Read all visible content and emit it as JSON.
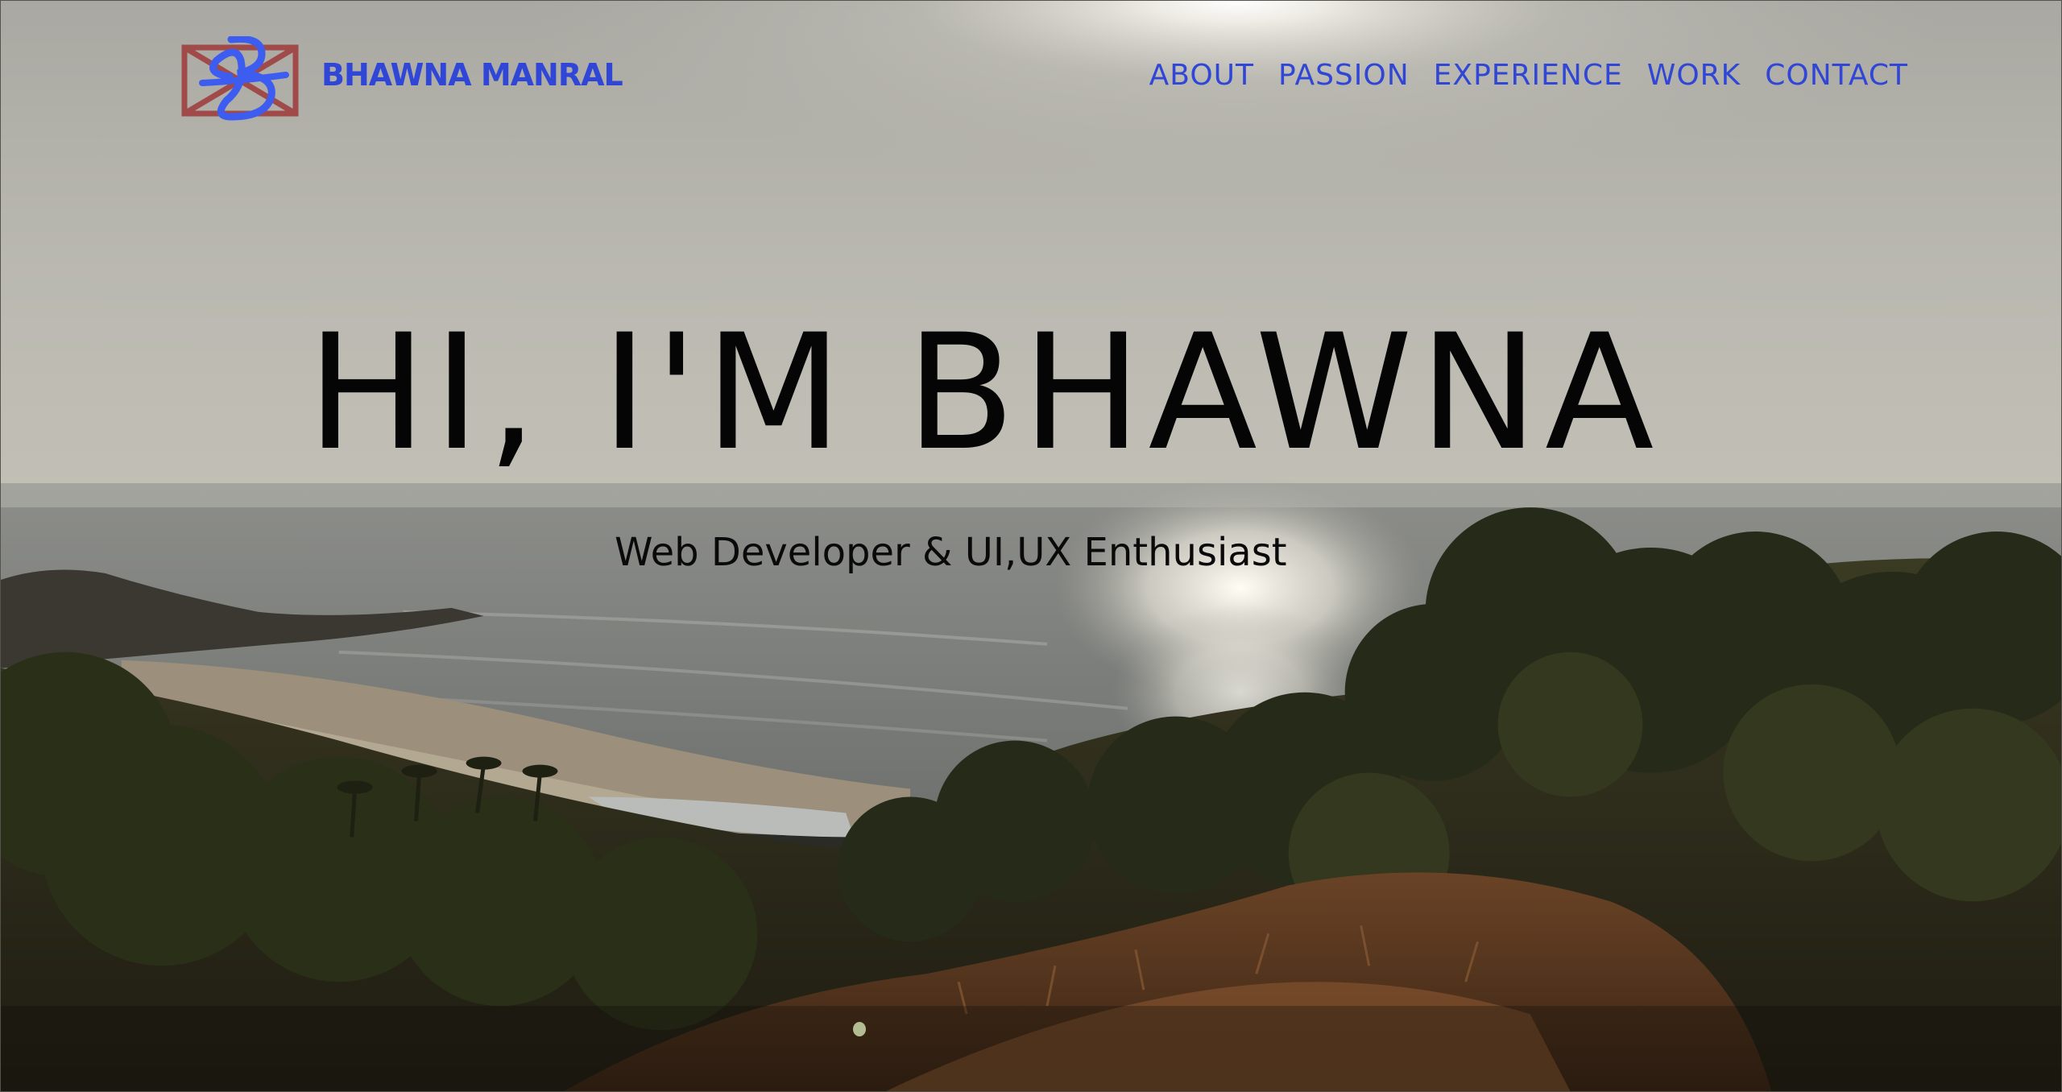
{
  "theme": {
    "accent": "#2f46d6",
    "hero_text": "#050505",
    "logo_mark_blue": "#3d5cf0",
    "logo_mark_red": "#a14a4a"
  },
  "header": {
    "brand": "BHAWNA MANRAL",
    "nav": [
      {
        "label": "ABOUT"
      },
      {
        "label": "PASSION"
      },
      {
        "label": "EXPERIENCE"
      },
      {
        "label": "WORK"
      },
      {
        "label": "CONTACT"
      }
    ]
  },
  "hero": {
    "title": "HI, I'M BHAWNA",
    "subtitle": "Web Developer & UI,UX Enthusiast",
    "background_icon": "beach-sunset-photo"
  }
}
